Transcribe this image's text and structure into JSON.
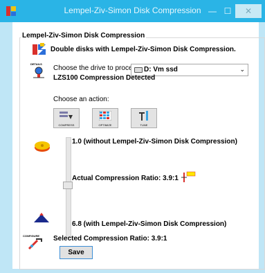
{
  "window": {
    "title": "Lempel-Ziv-Simon Disk Compression",
    "minimize_glyph": "—",
    "maximize_glyph": "☐",
    "close_glyph": "✕"
  },
  "group": {
    "title": "Lempel-Ziv-Simon Disk Compression"
  },
  "header": {
    "tagline": "Double disks with Lempel-Ziv-Simon Disk Compression."
  },
  "details": {
    "icon_label": "DETAILS",
    "drive_label": "Choose the drive to process:",
    "drive_value": "D: Vm ssd",
    "detected_text": "LZS100 Compression Detected"
  },
  "actions": {
    "label": "Choose an action:",
    "buttons": [
      {
        "label": "COMPRESS",
        "icon": "compress-icon"
      },
      {
        "label": "OPTIMIZE",
        "icon": "optimize-icon"
      },
      {
        "label": "TUNE",
        "icon": "tune-icon"
      }
    ]
  },
  "ratio": {
    "top_label": "1.0 (without Lempel-Ziv-Simon Disk Compression)",
    "actual_label": "Actual Compression Ratio: 3.9:1",
    "bottom_label": "6.8 (with Lempel-Ziv-Simon Disk Compression)",
    "slider_min": 1.0,
    "slider_max": 6.8,
    "slider_value": 3.9
  },
  "configure": {
    "icon_label": "CONFIGURE",
    "selected_label": "Selected Compression Ratio: 3.9:1",
    "save_label": "Save"
  },
  "colors": {
    "titlebar": "#2ab4e6",
    "window_border": "#bfe6f6"
  }
}
